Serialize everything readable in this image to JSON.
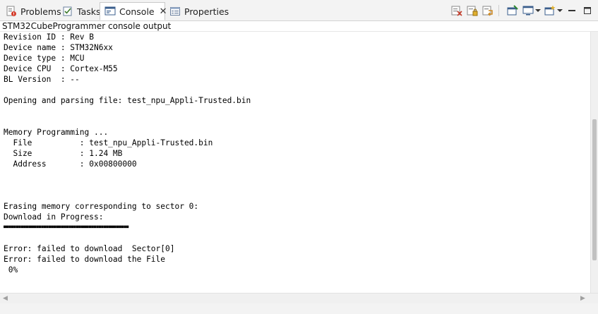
{
  "tabs": [
    {
      "label": "Problems",
      "icon": "problems-icon"
    },
    {
      "label": "Tasks",
      "icon": "tasks-icon"
    },
    {
      "label": "Console",
      "icon": "console-icon",
      "active": true,
      "close": "✕"
    },
    {
      "label": "Properties",
      "icon": "properties-icon"
    }
  ],
  "toolbar_icons": [
    "clear-console-icon",
    "scroll-lock-icon",
    "word-wrap-icon",
    "pin-console-icon",
    "display-console-icon",
    "new-console-icon",
    "minimize-icon",
    "maximize-icon"
  ],
  "console_title": "STM32CubeProgrammer console output",
  "console_lines": [
    "Revision ID : Rev B",
    "Device name : STM32N6xx",
    "Device type : MCU",
    "Device CPU  : Cortex-M55",
    "BL Version  : --",
    "",
    "Opening and parsing file: test_npu_Appli-Trusted.bin",
    "",
    "",
    "Memory Programming ...",
    "  File          : test_npu_Appli-Trusted.bin",
    "  Size          : 1.24 MB",
    "  Address       : 0x00800000",
    "",
    "",
    "",
    "Erasing memory corresponding to sector 0:",
    "Download in Progress:",
    "■■■■■■■■■■■■■■■■■■■■■■■■■■■■■■■■■■■■■■■■■■■■■■■■■■",
    "",
    "Error: failed to download  Sector[0]",
    "Error: failed to download the File",
    " 0%"
  ],
  "colors": {
    "tab_bar": "#f3f3f3",
    "console_bg": "#ffffff",
    "text": "#000000"
  }
}
